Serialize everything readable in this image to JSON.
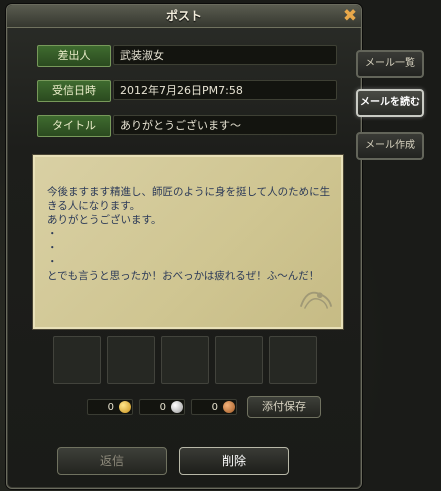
{
  "window": {
    "title": "ポスト"
  },
  "fields": {
    "sender_label": "差出人",
    "sender_value": "武装淑女",
    "date_label": "受信日時",
    "date_value": "2012年7月26日PM7:58",
    "subject_label": "タイトル",
    "subject_value": "ありがとうございます〜"
  },
  "letter": {
    "body": "今後ますます精進し、師匠のように身を挺して人のために生きる人になります。\nありがとうございます。\n・\n・\n・\nとでも言うと思ったか！おべっかは疲れるぜ！ふ〜んだ！"
  },
  "currency": {
    "gold": "0",
    "silver": "0",
    "copper": "0"
  },
  "buttons": {
    "save_attachments": "添付保存",
    "reply": "返信",
    "delete": "削除"
  },
  "side_tabs": [
    {
      "label": "メール一覧",
      "active": false
    },
    {
      "label": "メールを読む",
      "active": true
    },
    {
      "label": "メール作成",
      "active": false
    }
  ]
}
